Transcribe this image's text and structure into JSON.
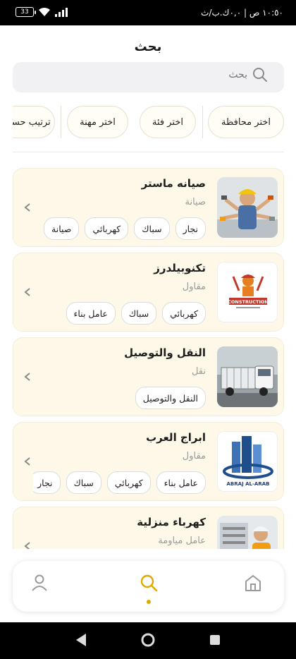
{
  "status_bar": {
    "battery": "33",
    "time_text": "١٠:٥٠ ص | ٠,٠ك.ب/ث"
  },
  "header": {
    "title": "بحث"
  },
  "search": {
    "placeholder": "بحث"
  },
  "filters": [
    "اختر محافظة",
    "اختر فئة",
    "اختر مهنة",
    "ترتيب حسب"
  ],
  "cards": [
    {
      "title": "صيانه ماستر",
      "subtitle": "صيانة",
      "tags": [
        "نجار",
        "سباك",
        "كهربائي",
        "صيانة"
      ]
    },
    {
      "title": "تكنوبيلدرز",
      "subtitle": "مقاول",
      "tags": [
        "كهربائي",
        "سباك",
        "عامل بناء"
      ],
      "logo_text": "CONSTRUCTION"
    },
    {
      "title": "النقل والتوصيل",
      "subtitle": "نقل",
      "tags": [
        "النقل والتوصيل"
      ]
    },
    {
      "title": "ابراج العرب",
      "subtitle": "مقاول",
      "tags": [
        "عامل بناء",
        "كهربائي",
        "سباك",
        "نجار"
      ],
      "logo_text": "ABRAJ AL-ARAB"
    },
    {
      "title": "كهرباء منزلية",
      "subtitle": "عامل مياومة",
      "tags": []
    }
  ],
  "colors": {
    "accent": "#e0a800",
    "card_bg": "#fdf8e7"
  },
  "icons": {
    "search": "search-icon",
    "back": "chevron-left-icon",
    "profile": "person-icon",
    "home": "home-icon"
  }
}
